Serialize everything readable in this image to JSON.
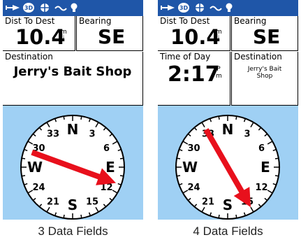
{
  "colors": {
    "statusbar": "#1f56a8",
    "background": "#9fd0f4",
    "arrow": "#e8101c",
    "cardinal": "#000000"
  },
  "status_icons": [
    "track-log-icon",
    "3d-satellite-icon",
    "gps-target-icon",
    "wave-icon",
    "bulb-icon"
  ],
  "status_3d_label": "3D",
  "left": {
    "caption": "3 Data Fields",
    "fields": [
      {
        "label": "Dist To Dest",
        "value": "10.4",
        "unit_top": "m",
        "unit_bottom": "i"
      },
      {
        "label": "Bearing",
        "value": "SE"
      },
      {
        "label": "Destination",
        "value": "Jerry's Bait Shop"
      }
    ],
    "compass": {
      "labels": [
        "N",
        "3",
        "6",
        "E",
        "12",
        "15",
        "S",
        "21",
        "24",
        "W",
        "30",
        "33"
      ],
      "bearing_deg": 110
    }
  },
  "right": {
    "caption": "4 Data Fields",
    "fields": [
      {
        "label": "Dist To Dest",
        "value": "10.4",
        "unit_top": "m",
        "unit_bottom": "i"
      },
      {
        "label": "Bearing",
        "value": "SE"
      },
      {
        "label": "Time of Day",
        "value": "2:17",
        "unit_top": "P",
        "unit_bottom": "m"
      },
      {
        "label": "Destination",
        "value_line1": "Jerry's Bait",
        "value_line2": "Shop"
      }
    ],
    "compass": {
      "labels": [
        "N",
        "3",
        "6",
        "E",
        "12",
        "15",
        "S",
        "21",
        "24",
        "W",
        "30",
        "33"
      ],
      "bearing_deg": 150
    }
  }
}
